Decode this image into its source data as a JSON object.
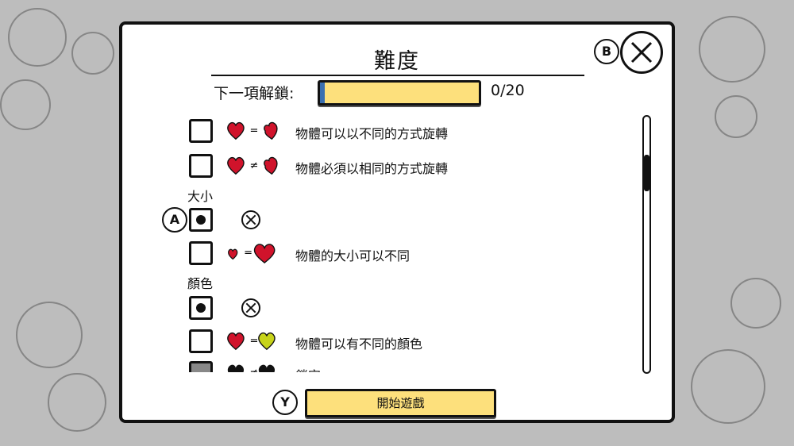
{
  "header": {
    "title": "難度"
  },
  "controls": {
    "close_hint": "B",
    "select_hint": "A",
    "start_hint": "Y"
  },
  "unlock": {
    "label": "下一項解鎖:",
    "count": "0/20",
    "progress": 0.02
  },
  "sections": {
    "size_label": "大小",
    "color_label": "顏色"
  },
  "options": {
    "rotate_any": {
      "desc": "物體可以以不同的方式旋轉",
      "symbol": "="
    },
    "rotate_same": {
      "desc": "物體必須以相同的方式旋轉",
      "symbol": "≠"
    },
    "size_diff": {
      "desc": "物體的大小可以不同",
      "symbol": "="
    },
    "color_diff": {
      "desc": "物體可以有不同的顏色",
      "symbol": "="
    },
    "locked": {
      "desc": "鎖定",
      "symbol": "≠"
    }
  },
  "footer": {
    "start_label": "開始遊戲"
  },
  "colors": {
    "heart_red": "#d0132b",
    "heart_yellow": "#c7d31a",
    "button_yellow": "#fde07c"
  }
}
